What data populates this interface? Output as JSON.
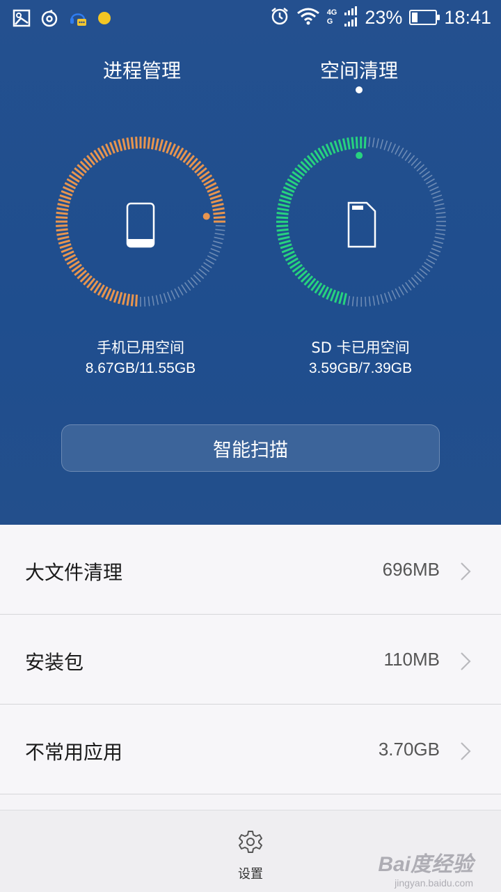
{
  "status_bar": {
    "network": [
      "4G",
      "G"
    ],
    "battery": "23%",
    "battery_level": 0.23,
    "time": "18:41"
  },
  "tabs": [
    {
      "label": "进程管理",
      "active": false
    },
    {
      "label": "空间清理",
      "active": true
    }
  ],
  "gauges": [
    {
      "label": "手机已用空间",
      "value": "8.67GB/11.55GB",
      "fraction": 0.7506,
      "color": "#e8954f"
    },
    {
      "label": "SD 卡已用空间",
      "value": "3.59GB/7.39GB",
      "fraction": 0.4858,
      "color": "#27d37f"
    }
  ],
  "scan_button": "智能扫描",
  "list": [
    {
      "title": "大文件清理",
      "value": "696MB"
    },
    {
      "title": "安装包",
      "value": "110MB"
    },
    {
      "title": "不常用应用",
      "value": "3.70GB"
    }
  ],
  "bottom": {
    "settings_label": "设置"
  },
  "watermark": {
    "main": "Bai度经验",
    "sub": "jingyan.baidu.com"
  }
}
